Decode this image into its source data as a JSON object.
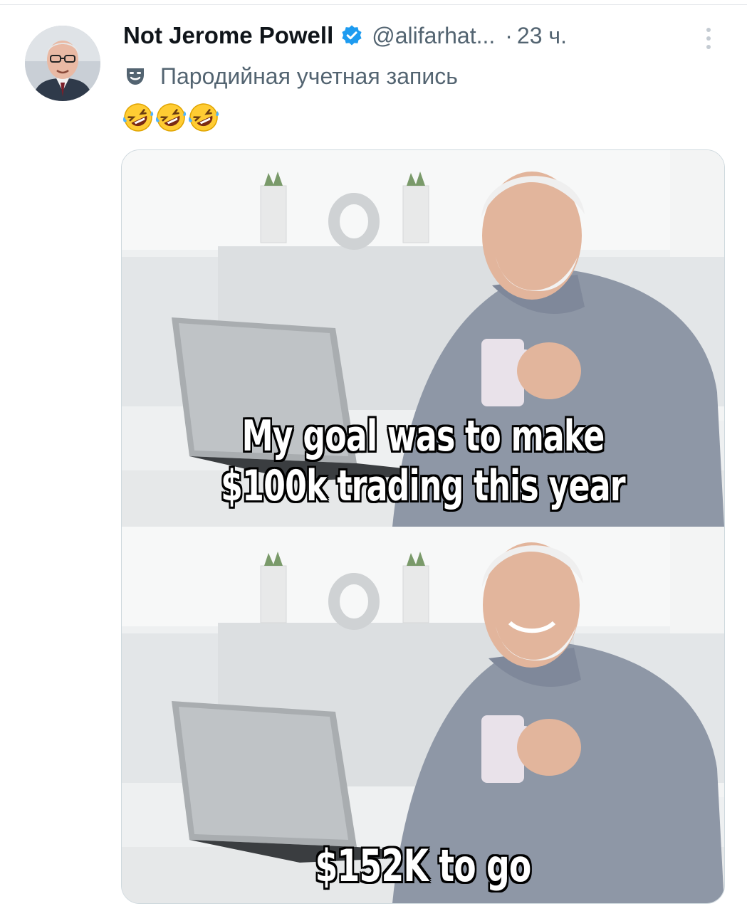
{
  "tweet": {
    "display_name": "Not Jerome Powell",
    "handle": "@alifarhat...",
    "separator": "·",
    "time": "23 ч.",
    "parody_label": "Пародийная учетная запись",
    "text_emojis": [
      "rolling-on-floor-laughing",
      "rolling-on-floor-laughing",
      "rolling-on-floor-laughing"
    ],
    "verified_color": "#1d9bf0"
  },
  "meme": {
    "top_caption_line1": "My goal was to make",
    "top_caption_line2": "$100k trading this year",
    "bottom_caption": "$152K to go"
  }
}
